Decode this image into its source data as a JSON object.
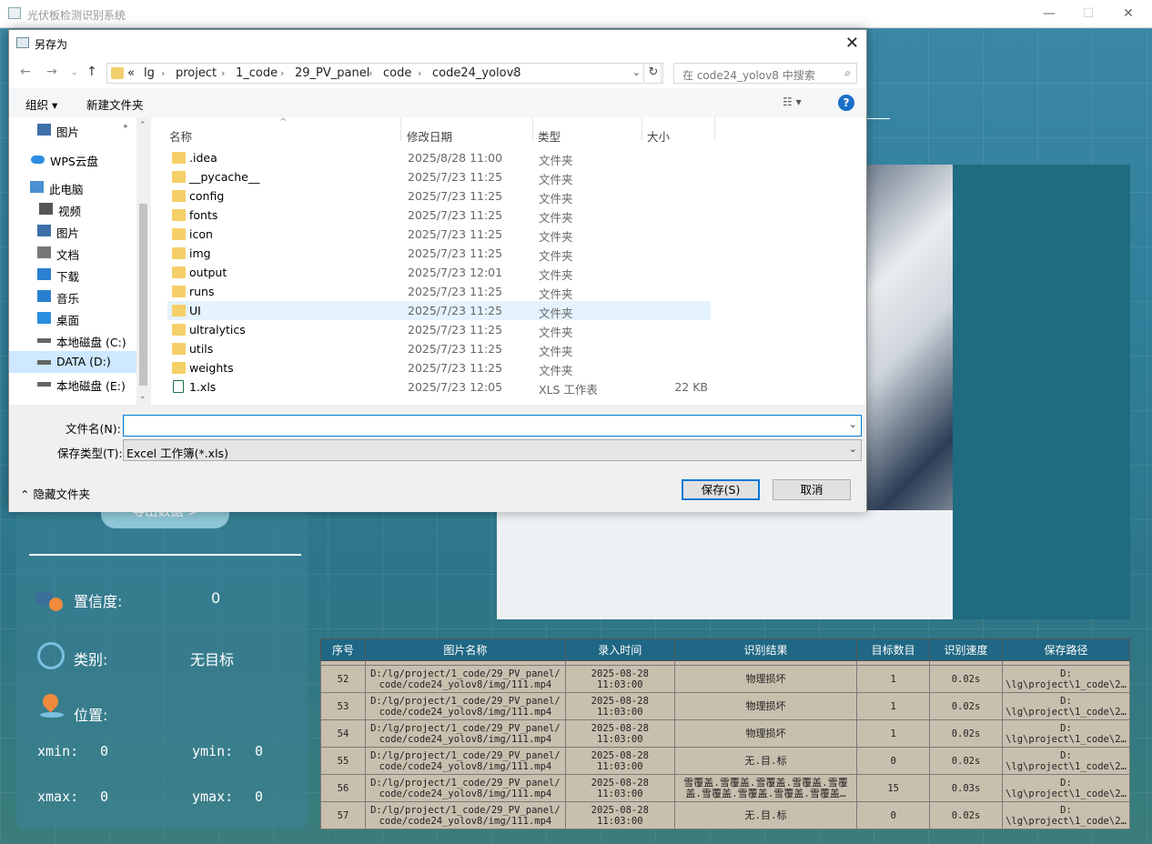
{
  "app": {
    "title": "光伏板检测识别系统",
    "export_label": "导出数据 >",
    "confidence_label": "置信度:",
    "confidence_value": "0",
    "class_label": "类别:",
    "class_value": "无目标",
    "position_label": "位置:",
    "xmin_label": "xmin:",
    "xmin_value": "0",
    "ymin_label": "ymin:",
    "ymin_value": "0",
    "xmax_label": "xmax:",
    "xmax_value": "0",
    "ymax_label": "ymax:",
    "ymax_value": "0"
  },
  "table": {
    "headers": [
      "序号",
      "图片名称",
      "录入时间",
      "识别结果",
      "目标数目",
      "识别速度",
      "保存路径"
    ],
    "rows": [
      {
        "id": "52",
        "name1": "D:/lg/project/1_code/29_PV_panel/",
        "name2": "code/code24_yolov8/img/111.mp4",
        "date": "2025-08-28",
        "time": "11:03:00",
        "result1": "物理损坏",
        "result2": "",
        "count": "1",
        "speed": "0.02s",
        "path1": "D:",
        "path2": "\\lg\\project\\1_code\\2…"
      },
      {
        "id": "53",
        "name1": "D:/lg/project/1_code/29_PV_panel/",
        "name2": "code/code24_yolov8/img/111.mp4",
        "date": "2025-08-28",
        "time": "11:03:00",
        "result1": "物理损坏",
        "result2": "",
        "count": "1",
        "speed": "0.02s",
        "path1": "D:",
        "path2": "\\lg\\project\\1_code\\2…"
      },
      {
        "id": "54",
        "name1": "D:/lg/project/1_code/29_PV_panel/",
        "name2": "code/code24_yolov8/img/111.mp4",
        "date": "2025-08-28",
        "time": "11:03:00",
        "result1": "物理损坏",
        "result2": "",
        "count": "1",
        "speed": "0.02s",
        "path1": "D:",
        "path2": "\\lg\\project\\1_code\\2…"
      },
      {
        "id": "55",
        "name1": "D:/lg/project/1_code/29_PV_panel/",
        "name2": "code/code24_yolov8/img/111.mp4",
        "date": "2025-08-28",
        "time": "11:03:00",
        "result1": "无.目.标",
        "result2": "",
        "count": "0",
        "speed": "0.02s",
        "path1": "D:",
        "path2": "\\lg\\project\\1_code\\2…"
      },
      {
        "id": "56",
        "name1": "D:/lg/project/1_code/29_PV_panel/",
        "name2": "code/code24_yolov8/img/111.mp4",
        "date": "2025-08-28",
        "time": "11:03:00",
        "result1": "雪覆盖.雪覆盖.雪覆盖.雪覆盖.雪覆",
        "result2": "盖.雪覆盖.雪覆盖.雪覆盖.雪覆盖…",
        "count": "15",
        "speed": "0.03s",
        "path1": "D:",
        "path2": "\\lg\\project\\1_code\\2…"
      },
      {
        "id": "57",
        "name1": "D:/lg/project/1_code/29_PV_panel/",
        "name2": "code/code24_yolov8/img/111.mp4",
        "date": "2025-08-28",
        "time": "11:03:00",
        "result1": "无.目.标",
        "result2": "",
        "count": "0",
        "speed": "0.02s",
        "path1": "D:",
        "path2": "\\lg\\project\\1_code\\2…"
      }
    ]
  },
  "dialog": {
    "title": "另存为",
    "breadcrumbs": [
      "«",
      "lg",
      "project",
      "1_code",
      "29_PV_panel",
      "code",
      "code24_yolov8"
    ],
    "search_placeholder": "在 code24_yolov8 中搜索",
    "organize": "组织 ▾",
    "new_folder": "新建文件夹",
    "nav_items": [
      {
        "label": "图片",
        "icon": "pictures-icon"
      },
      {
        "label": "WPS云盘",
        "icon": "cloud-icon"
      },
      {
        "label": "此电脑",
        "icon": "computer-icon"
      },
      {
        "label": "视频",
        "icon": "video-icon"
      },
      {
        "label": "图片",
        "icon": "pictures-icon"
      },
      {
        "label": "文档",
        "icon": "documents-icon"
      },
      {
        "label": "下载",
        "icon": "download-icon"
      },
      {
        "label": "音乐",
        "icon": "music-icon"
      },
      {
        "label": "桌面",
        "icon": "desktop-icon"
      },
      {
        "label": "本地磁盘 (C:)",
        "icon": "drive-icon"
      },
      {
        "label": "DATA (D:)",
        "icon": "drive-icon"
      },
      {
        "label": "本地磁盘 (E:)",
        "icon": "drive-icon"
      }
    ],
    "columns": {
      "name": "名称",
      "date": "修改日期",
      "type": "类型",
      "size": "大小"
    },
    "files": [
      {
        "name": ".idea",
        "date": "2025/8/28 11:00",
        "type": "文件夹",
        "size": ""
      },
      {
        "name": "__pycache__",
        "date": "2025/7/23 11:25",
        "type": "文件夹",
        "size": ""
      },
      {
        "name": "config",
        "date": "2025/7/23 11:25",
        "type": "文件夹",
        "size": ""
      },
      {
        "name": "fonts",
        "date": "2025/7/23 11:25",
        "type": "文件夹",
        "size": ""
      },
      {
        "name": "icon",
        "date": "2025/7/23 11:25",
        "type": "文件夹",
        "size": ""
      },
      {
        "name": "img",
        "date": "2025/7/23 11:25",
        "type": "文件夹",
        "size": ""
      },
      {
        "name": "output",
        "date": "2025/7/23 12:01",
        "type": "文件夹",
        "size": ""
      },
      {
        "name": "runs",
        "date": "2025/7/23 11:25",
        "type": "文件夹",
        "size": ""
      },
      {
        "name": "UI",
        "date": "2025/7/23 11:25",
        "type": "文件夹",
        "size": ""
      },
      {
        "name": "ultralytics",
        "date": "2025/7/23 11:25",
        "type": "文件夹",
        "size": ""
      },
      {
        "name": "utils",
        "date": "2025/7/23 11:25",
        "type": "文件夹",
        "size": ""
      },
      {
        "name": "weights",
        "date": "2025/7/23 11:25",
        "type": "文件夹",
        "size": ""
      },
      {
        "name": "1.xls",
        "date": "2025/7/23 12:05",
        "type": "XLS 工作表",
        "size": "22 KB"
      }
    ],
    "filename_label": "文件名(N):",
    "filename_value": "",
    "filetype_label": "保存类型(T):",
    "filetype_value": "Excel 工作簿(*.xls)",
    "hide_folders": "隐藏文件夹",
    "save": "保存(S)",
    "cancel": "取消"
  }
}
